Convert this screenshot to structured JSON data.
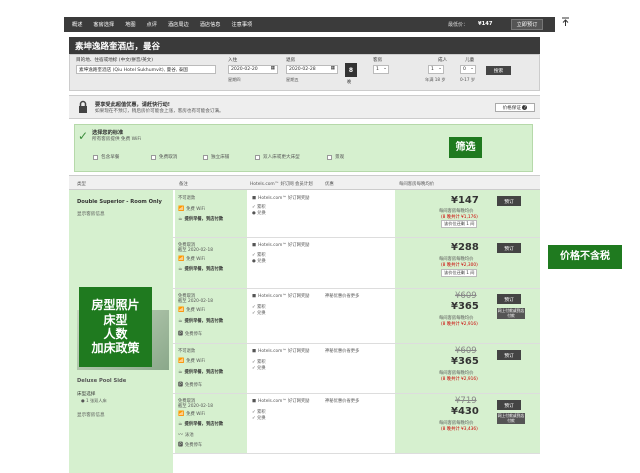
{
  "topnav": {
    "items": [
      "概述",
      "客房选择",
      "地图",
      "点评",
      "酒店周边",
      "酒店信息",
      "注意事项"
    ],
    "price_label": "最低价：",
    "price_value": "¥147",
    "book_now": "立即预订"
  },
  "hotel": {
    "title": "素坤逸路奎酒店，曼谷"
  },
  "search": {
    "dest_label": "目的地、住宿或地标 (中文/拼音/英文)",
    "dest_value": "素坤逸路奎酒店 (Qiu Hotel Sukhumvit), 曼谷, 泰国",
    "checkin_label": "入住",
    "checkin_value": "2020-02-20",
    "checkin_day": "星期四",
    "checkout_label": "退房",
    "checkout_value": "2020-02-28",
    "checkout_day": "星期五",
    "nights_value": "8",
    "nights_label": "晚",
    "rooms_label": "客房",
    "rooms_value": "1",
    "adults_label": "成人",
    "adults_value": "1",
    "adults_sub": "年满 18 岁",
    "kids_label": "儿童",
    "kids_value": "0",
    "kids_sub": "0-17 岁",
    "search_button": "搜索"
  },
  "promo": {
    "line1": "要享受此超值优惠，请赶快行动!",
    "line2": "如果现在不预订，稍后房价可能会上涨，客房也有可能会订满。",
    "guarantee": "价格保证"
  },
  "filter": {
    "title": "选择您的标准",
    "sub": "所有客房提供 免费 WiFi",
    "options": [
      "包含早餐",
      "免费取消",
      "独立床铺",
      "双人床或更大床型",
      "景观"
    ]
  },
  "annotations": {
    "filter_tag": "筛选",
    "room_tag_lines": [
      "房型照片",
      "床型",
      "人数",
      "加床政策"
    ],
    "price_tag": "价格不含税"
  },
  "table": {
    "headers": [
      "类型",
      "备注",
      "Hotels.com™ 好订网 会员计划",
      "优惠",
      "",
      "每间客房每晚均价"
    ],
    "room1_name": "Double Superior - Room Only",
    "room1_link": "显示客房信息",
    "room2_name": "Deluxe Pool Side",
    "room2_bed": "床型选择",
    "room2_bed_opt": "● 1 张双人床",
    "room2_link": "显示客房信息",
    "rows": [
      {
        "c1": [
          "不可退款",
          "免费 WiFi",
          "提供早餐，到店付款"
        ],
        "c2": [
          "Hotels.com™ 好订网奖励",
          "累积",
          "兑换"
        ],
        "c3": "",
        "strike": "",
        "price": "¥147",
        "per": "每间客房每晚均价",
        "total": "(8 晚共计 ¥1,176)",
        "pill": "该价位还剩 1 间",
        "book": "预订",
        "perk": ""
      },
      {
        "c1": [
          "免费取消",
          "截至 2020-02-18",
          "免费 WiFi",
          "提供早餐，到店付款"
        ],
        "c2": [
          "Hotels.com™ 好订网奖励",
          "累积",
          "兑换"
        ],
        "c3": "",
        "strike": "",
        "price": "¥288",
        "per": "每间客房每晚均价",
        "total": "(8 晚共计 ¥2,300)",
        "pill": "该价位还剩 1 间",
        "book": "预订",
        "perk": ""
      },
      {
        "c1": [
          "免费取消",
          "截至 2020-02-18",
          "免费 WiFi",
          "提供早餐，到店付款",
          "免费停车"
        ],
        "c2": [
          "Hotels.com™ 好订网奖励",
          "累积",
          "兑换"
        ],
        "c3": "神秘优惠价省更多",
        "strike": "¥609",
        "price": "¥365",
        "per": "每间客房每晚均价",
        "total": "(8 晚共计 ¥2,916)",
        "pill": "",
        "book": "预订",
        "perk": "网上付款或到店付款"
      },
      {
        "c1": [
          "不可退款",
          "免费 WiFi",
          "提供早餐，到店付款",
          "免费停车"
        ],
        "c2": [
          "Hotels.com™ 好订网奖励",
          "累积",
          "兑换"
        ],
        "c3": "神秘优惠价省更多",
        "strike": "¥609",
        "price": "¥365",
        "per": "每间客房每晚均价",
        "total": "(8 晚共计 ¥2,916)",
        "pill": "",
        "book": "预订",
        "perk": ""
      },
      {
        "c1": [
          "免费取消",
          "截至 2020-02-18",
          "免费 WiFi",
          "提供早餐，到店付款",
          "泳池",
          "免费停车"
        ],
        "c2": [
          "Hotels.com™ 好订网奖励",
          "累积",
          "兑换"
        ],
        "c3": "神秘优惠价省更多",
        "strike": "¥719",
        "price": "¥430",
        "per": "每间客房每晚均价",
        "total": "(8 晚共计 ¥3,436)",
        "pill": "",
        "book": "预订",
        "perk": "网上付款或到店付款"
      }
    ]
  }
}
